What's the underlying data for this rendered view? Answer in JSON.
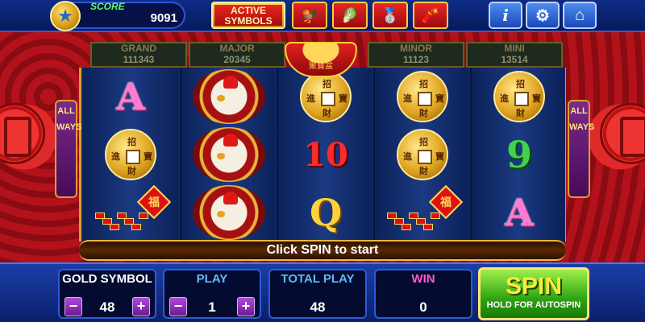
{
  "header": {
    "score_label": "SCORE",
    "score_value": "9091",
    "active_symbols_line1": "ACTIVE",
    "active_symbols_line2": "SYMBOLS",
    "info_label": "i",
    "settings_label": "⚙",
    "home_label": "⌂"
  },
  "jackpots": [
    {
      "name": "GRAND",
      "value": "111343"
    },
    {
      "name": "MAJOR",
      "value": "20345"
    },
    {
      "name": "MINOR",
      "value": "11123"
    },
    {
      "name": "MINI",
      "value": "13514"
    }
  ],
  "allways": {
    "line1": "ALL",
    "line2": "WAYS"
  },
  "reels": {
    "reel1": [
      "A",
      "coin",
      "firecracker"
    ],
    "reel2": [
      "rooster",
      "rooster",
      "rooster"
    ],
    "reel3": [
      "coin",
      "10",
      "Q"
    ],
    "reel4": [
      "coin",
      "coin",
      "firecracker"
    ],
    "reel5": [
      "coin",
      "9",
      "A"
    ]
  },
  "coin_chars": {
    "top": "招",
    "left": "進",
    "right": "寶",
    "bottom": "財"
  },
  "fu_char": "福",
  "message": "Click SPIN to start",
  "controls": {
    "gold_symbol_label": "GOLD SYMBOL",
    "gold_symbol_value": "48",
    "play_label": "PLAY",
    "play_value": "1",
    "total_play_label": "TOTAL PLAY",
    "total_play_value": "48",
    "win_label": "WIN",
    "win_value": "0",
    "minus": "−",
    "plus": "+",
    "spin_label": "SPIN",
    "spin_sub": "HOLD FOR AUTOSPIN"
  },
  "colors": {
    "gold_label": "#ffffff",
    "play_label": "#62b6ff",
    "total_label": "#62b6ff",
    "win_label": "#ff5ad2"
  }
}
